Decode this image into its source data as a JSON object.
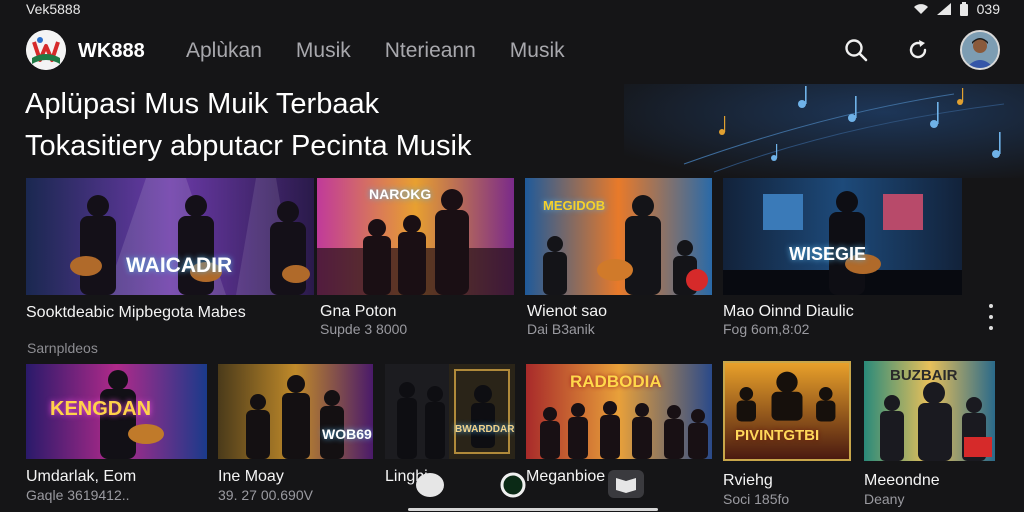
{
  "status_bar": {
    "carrier": "Vek5888",
    "time": "039"
  },
  "app_bar": {
    "brand": "WK888",
    "nav": [
      "Aplùkan",
      "Musik",
      "Nterieann",
      "Musik"
    ],
    "icons": [
      "search-icon",
      "refresh-icon",
      "avatar"
    ]
  },
  "hero": {
    "title": "Aplüpasi Mus Muik Terbaak",
    "subtitle": "Tokasitiery abputacr Pecinta Musik"
  },
  "featured": [
    {
      "thumb_text": "WAICADIR",
      "title": "Sooktdeabic Mipbegota Mabes",
      "meta": ""
    },
    {
      "thumb_text": "NAROKG",
      "title": "Gna Poton",
      "meta": "Supde 3 8000"
    },
    {
      "thumb_text": "MEGIDOB",
      "title": "Wienot sao",
      "meta": "Dai B3anik"
    },
    {
      "thumb_text": "WISEGIE",
      "title": "Mao Oinnd Diaulic",
      "meta": "Fog 6om,8:02"
    }
  ],
  "section_label": "Sarnpldeos",
  "grid": [
    {
      "thumb_text": "KENGDAN",
      "title": "Umdarlak, Eom",
      "meta": "Gaqle 3619412.."
    },
    {
      "thumb_text": "WOB69",
      "title": "Ine Moay",
      "meta": "39. 27 00.690V"
    },
    {
      "thumb_text": "BWARDDAR",
      "title": "Linghi",
      "meta": ""
    },
    {
      "thumb_text": "RADBODIA",
      "title": "Meganbioe",
      "meta": ""
    },
    {
      "thumb_text": "PIVINTGTBI",
      "title": "Rviehg",
      "meta": "Soci 185fo"
    },
    {
      "thumb_text": "BUZBAIR",
      "title": "Meeondne",
      "meta": "Deany"
    }
  ],
  "colors": {
    "background": "#151517",
    "accent_red": "#d62a2a",
    "accent_green": "#1f7a45"
  }
}
